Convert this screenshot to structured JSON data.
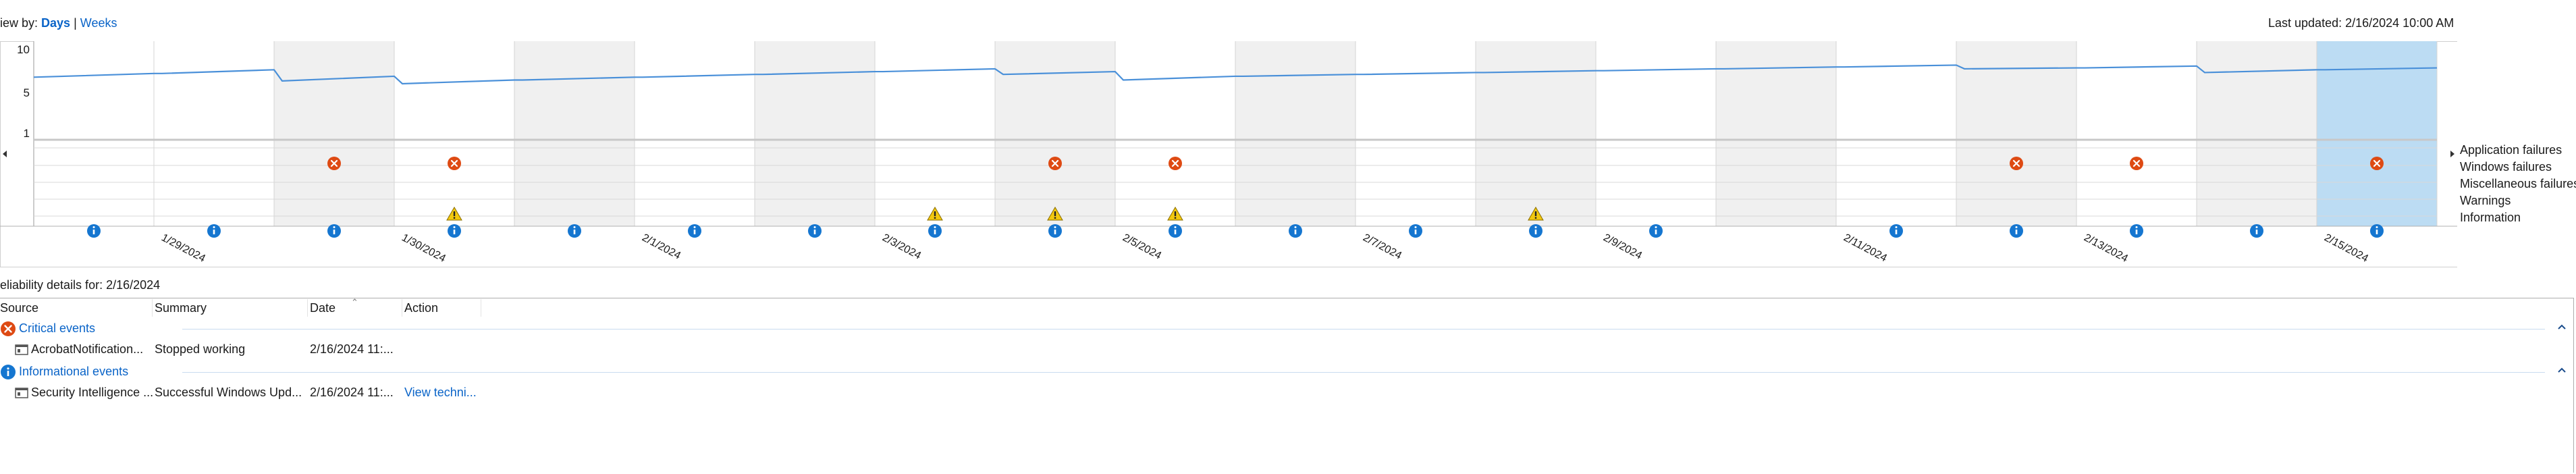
{
  "view_by": {
    "prefix": "iew by: ",
    "days": "Days",
    "separator": "|",
    "weeks": "Weeks"
  },
  "last_updated": "Last updated: 2/16/2024 10:00 AM",
  "chart": {
    "y_ticks": [
      "10",
      "5",
      "1"
    ],
    "date_labels": [
      "1/29/2024",
      "1/30/2024",
      "2/1/2024",
      "2/3/2024",
      "2/5/2024",
      "2/7/2024",
      "2/9/2024",
      "2/11/2024",
      "2/13/2024",
      "2/15/2024"
    ],
    "legend": [
      "Application failures",
      "Windows failures",
      "Miscellaneous failures",
      "Warnings",
      "Information"
    ],
    "colors": {
      "critical": "#de4a13",
      "info": "#1576d0",
      "warning": "#f2c80f",
      "line": "#4a90d9",
      "selected": "#bcdcf3",
      "shaded": "#f0f0f0"
    }
  },
  "chart_data": {
    "type": "line",
    "title": "",
    "xlabel": "",
    "ylabel": "",
    "ylim": [
      1,
      10
    ],
    "y_ticks": [
      10,
      5,
      1
    ],
    "x": [
      "1/28/2024",
      "1/29/2024",
      "1/30/2024",
      "1/31/2024",
      "2/1/2024",
      "2/2/2024",
      "2/3/2024",
      "2/4/2024",
      "2/5/2024",
      "2/6/2024",
      "2/7/2024",
      "2/8/2024",
      "2/9/2024",
      "2/10/2024",
      "2/11/2024",
      "2/12/2024",
      "2/13/2024",
      "2/14/2024",
      "2/15/2024",
      "2/16/2024"
    ],
    "stability_index": [
      {
        "start": 7.0,
        "end": 7.4
      },
      {
        "start": 7.4,
        "end": 7.8
      },
      {
        "start": 6.6,
        "end": 7.1
      },
      {
        "start": 6.3,
        "end": 6.7
      },
      {
        "start": 6.7,
        "end": 7.0
      },
      {
        "start": 7.0,
        "end": 7.3
      },
      {
        "start": 7.3,
        "end": 7.6
      },
      {
        "start": 7.6,
        "end": 7.9
      },
      {
        "start": 7.3,
        "end": 7.6
      },
      {
        "start": 6.7,
        "end": 7.1
      },
      {
        "start": 7.1,
        "end": 7.3
      },
      {
        "start": 7.3,
        "end": 7.5
      },
      {
        "start": 7.5,
        "end": 7.7
      },
      {
        "start": 7.7,
        "end": 7.9
      },
      {
        "start": 7.9,
        "end": 8.1
      },
      {
        "start": 8.1,
        "end": 8.3
      },
      {
        "start": 7.9,
        "end": 8.0
      },
      {
        "start": 8.0,
        "end": 8.2
      },
      {
        "start": 7.5,
        "end": 7.8
      },
      {
        "start": 7.8,
        "end": 8.0
      }
    ],
    "shaded_days": [
      2,
      4,
      6,
      8,
      10,
      12,
      14,
      16,
      18
    ],
    "selected_day": 19,
    "application_failures": [
      2,
      3,
      8,
      9,
      16,
      17,
      19
    ],
    "warnings": [
      3,
      7,
      8,
      9,
      12
    ],
    "information": [
      0,
      1,
      2,
      3,
      4,
      5,
      6,
      7,
      8,
      9,
      10,
      11,
      12,
      13,
      15,
      16,
      17,
      18,
      19
    ]
  },
  "details": {
    "title": "eliability details for: 2/16/2024",
    "columns": [
      "Source",
      "Summary",
      "Date",
      "Action"
    ],
    "groups": [
      {
        "label": "Critical events",
        "type": "critical",
        "rows": [
          {
            "source": "AcrobatNotification...",
            "summary": "Stopped working",
            "date": "2/16/2024 11:...",
            "action": ""
          }
        ]
      },
      {
        "label": "Informational events",
        "type": "info",
        "rows": [
          {
            "source": "Security Intelligence ...",
            "summary": "Successful Windows Upd...",
            "date": "2/16/2024 11:...",
            "action": "View techni..."
          }
        ]
      }
    ]
  }
}
